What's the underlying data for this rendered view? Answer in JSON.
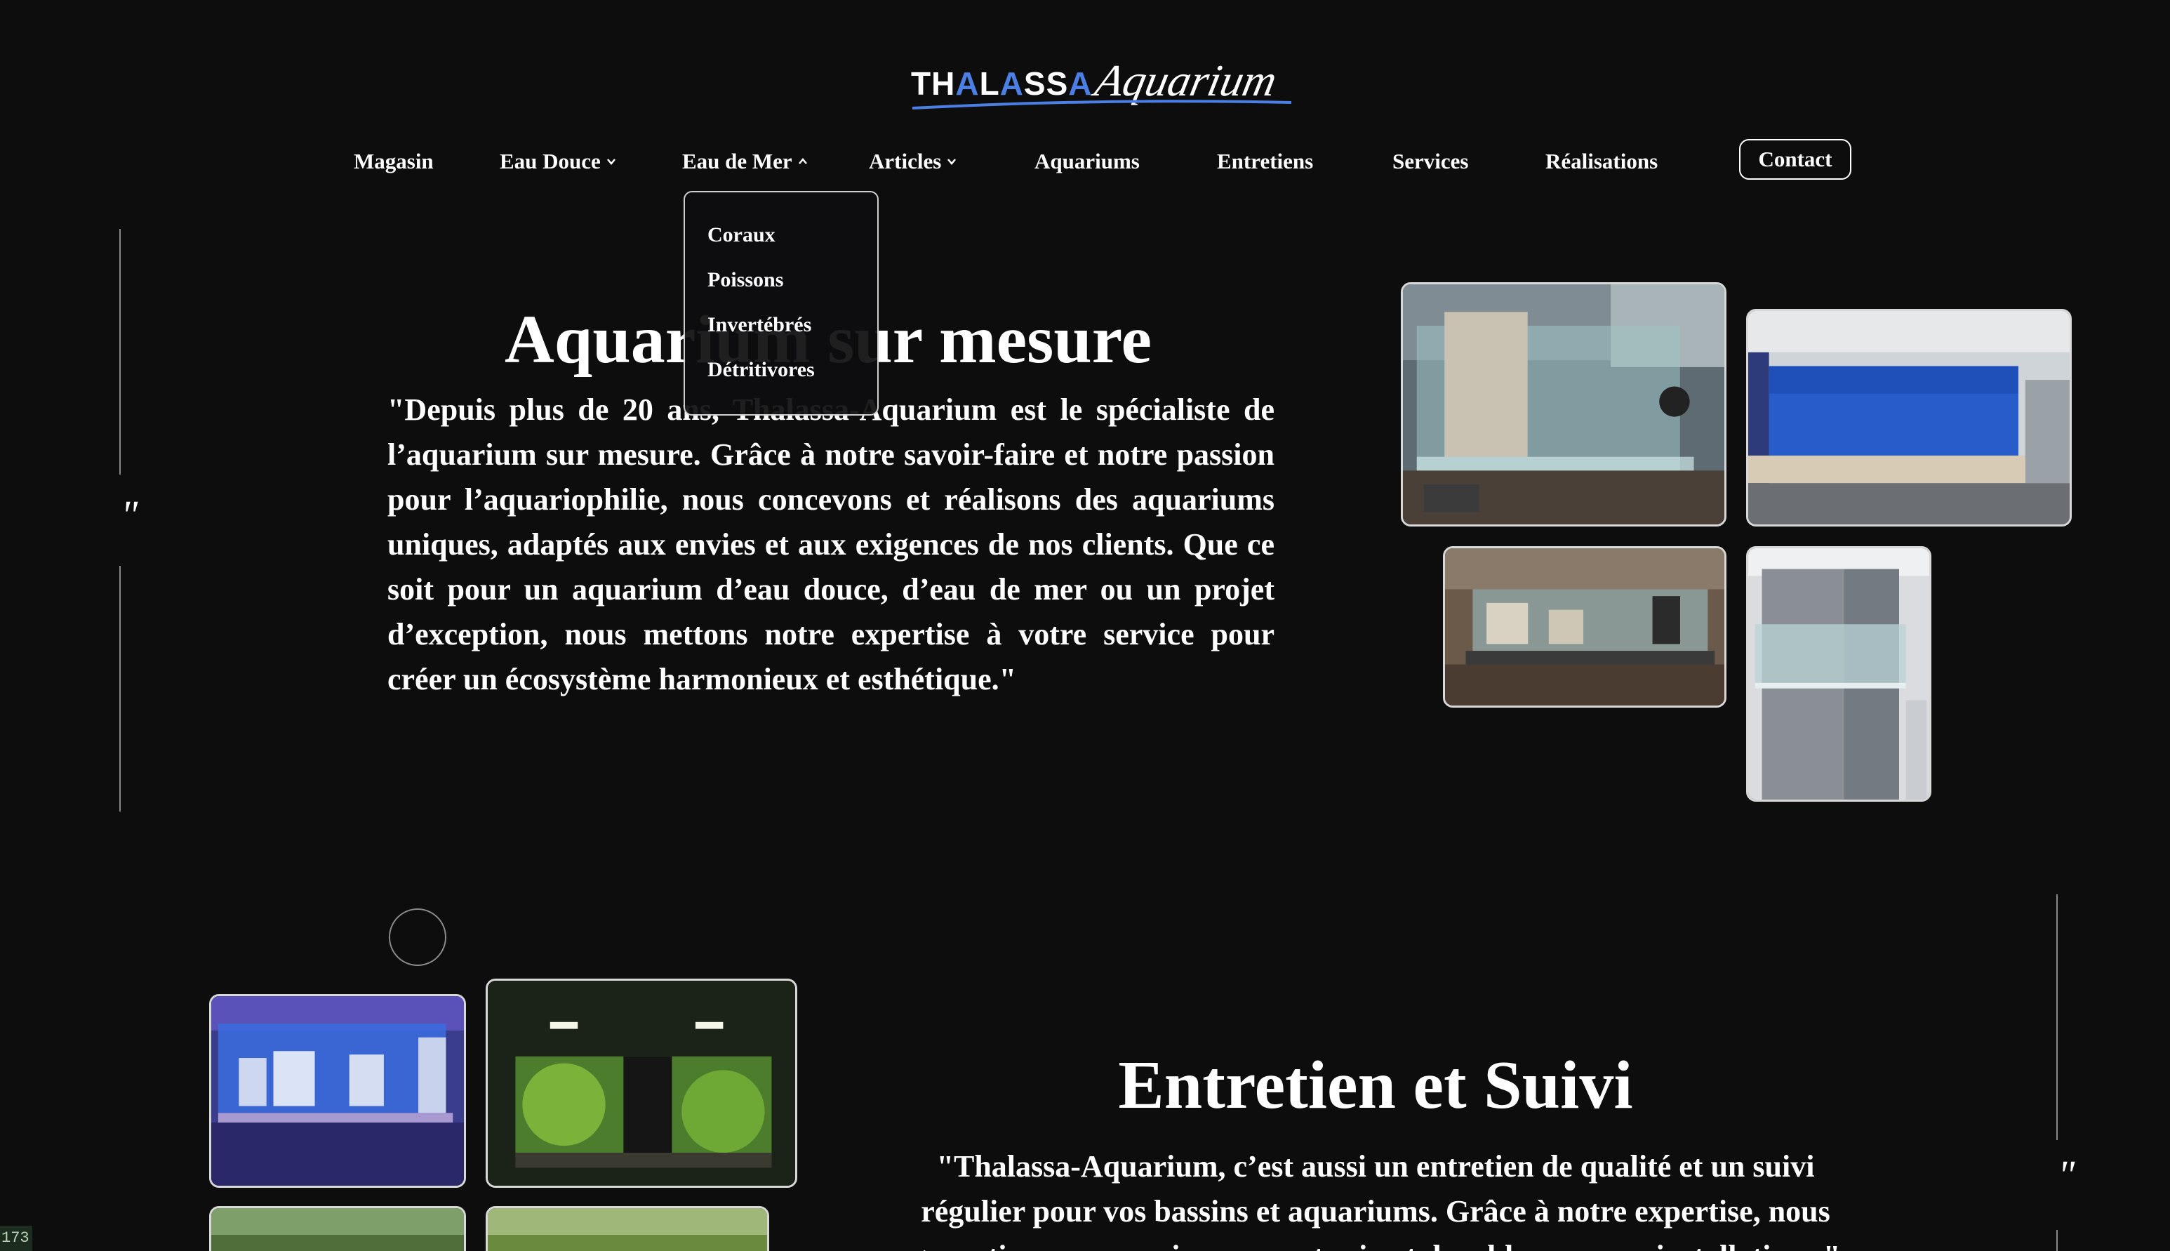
{
  "logo": {
    "brand_prefix": "TH",
    "brand_a1": "A",
    "brand_mid": "L",
    "brand_a2": "A",
    "brand_suffix": "SS",
    "brand_a3": "A",
    "script": "Aquarium",
    "accent_color": "#4b7fe3"
  },
  "nav": {
    "items": [
      {
        "label": "Magasin"
      },
      {
        "label": "Eau Douce",
        "has_menu": true,
        "icon": "chevron-down-icon"
      },
      {
        "label": "Eau de Mer",
        "has_menu": true,
        "icon": "chevron-up-icon",
        "open": true
      },
      {
        "label": "Articles",
        "has_menu": true,
        "icon": "chevron-down-icon"
      },
      {
        "label": "Aquariums"
      },
      {
        "label": "Entretiens"
      },
      {
        "label": "Services"
      },
      {
        "label": "Réalisations"
      }
    ],
    "contact_label": "Contact"
  },
  "dropdown": {
    "items": [
      "Coraux",
      "Poissons",
      "Invertébrés",
      "Détritivores"
    ]
  },
  "section1": {
    "title": "Aquarium sur mesure",
    "quote_mark": "\"",
    "text": "\"Depuis plus de 20 ans, Thalassa-Aquarium est le spécialiste de l’aquarium sur mesure. Grâce à notre savoir-faire et notre passion pour l’aquariophilie, nous concevons et réalisons des aquariums uniques, adaptés aux envies et aux exigences de nos clients. Que ce soit pour un aquarium d’eau douce, d’eau de mer ou un projet d’exception, nous mettons notre expertise à votre service pour créer un écosystème harmonieux et esthétique.\""
  },
  "section2": {
    "title": "Entretien et Suivi",
    "quote_mark": "\"",
    "text": "\"Thalassa-Aquarium, c’est aussi un entretien de qualité et un suivi régulier pour vos bassins et aquariums. Grâce à notre expertise, nous garantissons un environnement sain et durable pour vos installations.\""
  },
  "corner_badge": "173"
}
